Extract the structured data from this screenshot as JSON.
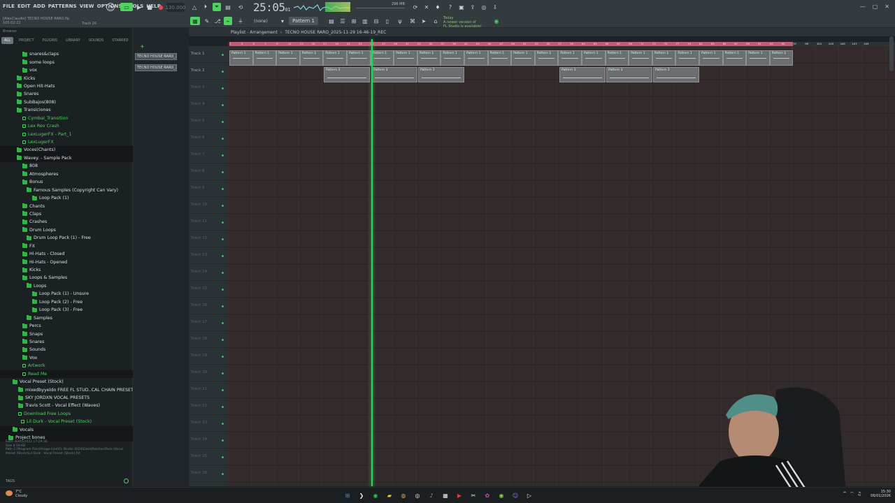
{
  "menu": [
    "FILE",
    "EDIT",
    "ADD",
    "PATTERNS",
    "VIEW",
    "OPTIONS",
    "TOOLS",
    "HELP"
  ],
  "project": {
    "user": "[AlexClaudio] TECNO HOUSE RARO.flp",
    "position": "105:02:22",
    "track_hint": "Track 26"
  },
  "transport": {
    "bpm": "130.000",
    "time": "25:05",
    "time_sub": "01",
    "pattern": "Pattern 1",
    "snap": "(none)",
    "mem": "296 MB"
  },
  "news": {
    "line1": "Today",
    "line2": "A newer version of",
    "line3": "FL Studio is available!"
  },
  "browser": {
    "header": "Browser",
    "tabs": [
      "ALL",
      "PROJECT",
      "PLUGINS",
      "LIBRARY",
      "SOUNDS",
      "STARRED"
    ],
    "items": [
      {
        "label": "snares&claps",
        "indent": 32,
        "type": "folder"
      },
      {
        "label": "some loops",
        "indent": 32,
        "type": "folder"
      },
      {
        "label": "vox",
        "indent": 32,
        "type": "folder"
      },
      {
        "label": "Kicks",
        "indent": 24,
        "type": "folder"
      },
      {
        "label": "Open Hit-Hats",
        "indent": 24,
        "type": "folder"
      },
      {
        "label": "Snares",
        "indent": 24,
        "type": "folder"
      },
      {
        "label": "SubBajos(808)",
        "indent": 24,
        "type": "folder"
      },
      {
        "label": "Transiciones",
        "indent": 24,
        "type": "folder"
      },
      {
        "label": "Cymbal_Transition",
        "indent": 32,
        "type": "file"
      },
      {
        "label": "Lex Rev Crash",
        "indent": 32,
        "type": "file"
      },
      {
        "label": "LexLugerFX - Part_1",
        "indent": 32,
        "type": "file"
      },
      {
        "label": "LexLugerFX",
        "indent": 32,
        "type": "file"
      },
      {
        "label": "Voces(Chants)",
        "indent": 24,
        "type": "folder"
      },
      {
        "label": "Wavey. - Sample Pack",
        "indent": 24,
        "type": "folder"
      },
      {
        "label": "808",
        "indent": 32,
        "type": "folder"
      },
      {
        "label": "Atmospheres",
        "indent": 32,
        "type": "folder"
      },
      {
        "label": "Bonus",
        "indent": 32,
        "type": "folder"
      },
      {
        "label": "Famous Samples (Copyright Can Vary)",
        "indent": 38,
        "type": "folder"
      },
      {
        "label": "Loop Pack (1)",
        "indent": 46,
        "type": "folder"
      },
      {
        "label": "Chants",
        "indent": 32,
        "type": "folder"
      },
      {
        "label": "Claps",
        "indent": 32,
        "type": "folder"
      },
      {
        "label": "Crashes",
        "indent": 32,
        "type": "folder"
      },
      {
        "label": "Drum Loops",
        "indent": 32,
        "type": "folder"
      },
      {
        "label": "Drum Loop Pack (1) - Free",
        "indent": 38,
        "type": "folder"
      },
      {
        "label": "FX",
        "indent": 32,
        "type": "folder"
      },
      {
        "label": "Hi-Hats - Closed",
        "indent": 32,
        "type": "folder"
      },
      {
        "label": "Hi-Hats - Opened",
        "indent": 32,
        "type": "folder"
      },
      {
        "label": "Kicks",
        "indent": 32,
        "type": "folder"
      },
      {
        "label": "Loops & Samples",
        "indent": 32,
        "type": "folder"
      },
      {
        "label": "Loops",
        "indent": 38,
        "type": "folder"
      },
      {
        "label": "Loop Pack (1) - Unsure",
        "indent": 46,
        "type": "folder"
      },
      {
        "label": "Loop Pack (2) - Free",
        "indent": 46,
        "type": "folder"
      },
      {
        "label": "Loop Pack (3) - Free",
        "indent": 46,
        "type": "folder"
      },
      {
        "label": "Samples",
        "indent": 38,
        "type": "folder"
      },
      {
        "label": "Percs",
        "indent": 32,
        "type": "folder"
      },
      {
        "label": "Snaps",
        "indent": 32,
        "type": "folder"
      },
      {
        "label": "Snares",
        "indent": 32,
        "type": "folder"
      },
      {
        "label": "Sounds",
        "indent": 32,
        "type": "folder"
      },
      {
        "label": "Vox",
        "indent": 32,
        "type": "folder"
      },
      {
        "label": "Artwork",
        "indent": 32,
        "type": "file"
      },
      {
        "label": "Read Me",
        "indent": 32,
        "type": "file"
      },
      {
        "label": "Vocal Preset (Stock)",
        "indent": 18,
        "type": "folder"
      },
      {
        "label": "mixedbyyeldo FREE FL STUD..CAL CHAIN PRESETS VOL. 2",
        "indent": 26,
        "type": "folder"
      },
      {
        "label": "SKY JORDXN VOCAL PRESETS",
        "indent": 26,
        "type": "folder"
      },
      {
        "label": "Travis Scott - Vocal Effect (Waves)",
        "indent": 26,
        "type": "folder"
      },
      {
        "label": "Download Free Loops",
        "indent": 26,
        "type": "file"
      },
      {
        "label": "Lil Durk - Vocal Preset (Stock)",
        "indent": 30,
        "type": "file"
      },
      {
        "label": "Vocals",
        "indent": 18,
        "type": "folder"
      },
      {
        "label": "Project bones",
        "indent": 12,
        "type": "folder"
      }
    ],
    "info": {
      "date": "Date   30/05/2022 17:29:36",
      "size": "Size   4.59 KB",
      "path": "Path   C:\\Program Files\\Image-Line\\FL Studio 2024\\Data\\Patches\\Pack-\\Vocal Preset (Stock)\\Lil Durk - Vocal Preset (Stock).fst"
    },
    "tags": "TAGS"
  },
  "patterns": [
    "TECNO HOUSE RARO_2025",
    "TECNO HOUSE RARO_2025"
  ],
  "playlist": {
    "title": "Playlist - Arrangement",
    "file": "TECNO HOUSE RARO_2025-11-29 16-46-19_REC",
    "tracks": [
      "Track 1",
      "Track 2",
      "Track 3",
      "Track 4",
      "Track 5",
      "Track 6",
      "Track 7",
      "Track 8",
      "Track 9",
      "Track 10",
      "Track 11",
      "Track 12",
      "Track 13",
      "Track 14",
      "Track 15",
      "Track 16",
      "Track 17",
      "Track 18",
      "Track 19",
      "Track 20",
      "Track 21",
      "Track 22",
      "Track 23",
      "Track 24",
      "Track 25",
      "Track 26"
    ],
    "track1_clip_label": "Pattern 1",
    "track2_clip_label": "Pattern 3",
    "bars": [
      "1",
      "3",
      "5",
      "7",
      "9",
      "11",
      "13",
      "15",
      "17",
      "19",
      "21",
      "23",
      "25",
      "27",
      "29",
      "31",
      "33",
      "35",
      "37",
      "39",
      "41",
      "43",
      "45",
      "47",
      "49",
      "51",
      "53",
      "55",
      "57",
      "59",
      "61",
      "63",
      "65",
      "67",
      "69",
      "71",
      "73",
      "75",
      "77",
      "79",
      "81",
      "83",
      "85",
      "87",
      "89",
      "91",
      "93",
      "95",
      "97",
      "99",
      "101",
      "103",
      "105",
      "107",
      "109"
    ]
  },
  "taskbar": {
    "weather_temp": "7°C",
    "weather_desc": "Cloudy",
    "time": "15:30",
    "date": "06/01/2026"
  },
  "colors": {
    "accent_green": "#35b24a",
    "playhead": "#29d456",
    "ruler": "#c25b74"
  }
}
